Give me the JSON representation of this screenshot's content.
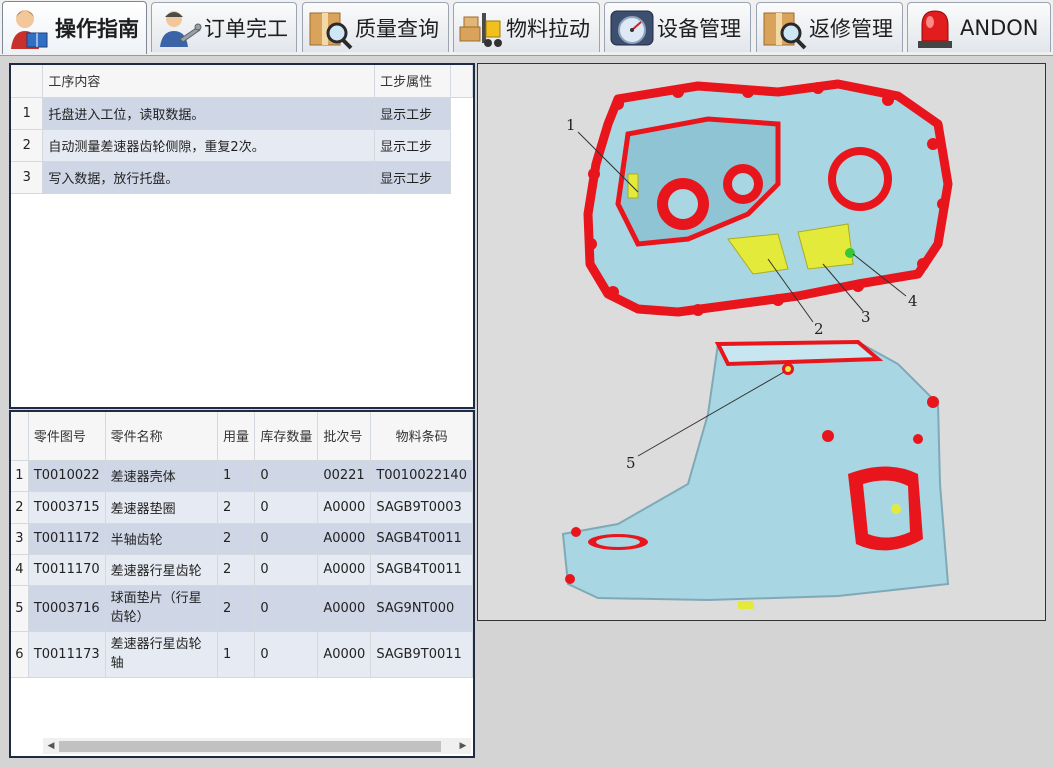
{
  "tabs": [
    {
      "label": "操作指南",
      "icon": "operator-book-icon",
      "active": true
    },
    {
      "label": "订单完工",
      "icon": "worker-wrench-icon",
      "active": false
    },
    {
      "label": "质量查询",
      "icon": "box-magnifier-icon",
      "active": false
    },
    {
      "label": "物料拉动",
      "icon": "forklift-icon",
      "active": false
    },
    {
      "label": "设备管理",
      "icon": "gauge-icon",
      "active": false
    },
    {
      "label": "返修管理",
      "icon": "box-magnifier-icon",
      "active": false
    },
    {
      "label": "ANDON",
      "icon": "alarm-light-icon",
      "active": false
    }
  ],
  "steps_table": {
    "headers": {
      "content": "工序内容",
      "attribute": "工步属性"
    },
    "rows": [
      {
        "index": "1",
        "content": "托盘进入工位，读取数据。",
        "attribute": "显示工步"
      },
      {
        "index": "2",
        "content": "自动测量差速器齿轮侧隙，重复2次。",
        "attribute": "显示工步"
      },
      {
        "index": "3",
        "content": "写入数据，放行托盘。",
        "attribute": "显示工步"
      }
    ]
  },
  "parts_table": {
    "headers": {
      "part_no": "零件图号",
      "part_name": "零件名称",
      "qty": "用量",
      "stock": "库存数量",
      "batch": "批次号",
      "barcode": "物料条码"
    },
    "rows": [
      {
        "index": "1",
        "part_no": "T0010022",
        "part_name": "差速器壳体",
        "qty": "1",
        "stock": "0",
        "batch": "00221",
        "barcode": "T0010022140"
      },
      {
        "index": "2",
        "part_no": "T0003715",
        "part_name": "差速器垫圈",
        "qty": "2",
        "stock": "0",
        "batch": "A0000",
        "barcode": "SAGB9T0003"
      },
      {
        "index": "3",
        "part_no": "T0011172",
        "part_name": "半轴齿轮",
        "qty": "2",
        "stock": "0",
        "batch": "A0000",
        "barcode": "SAGB4T0011"
      },
      {
        "index": "4",
        "part_no": "T0011170",
        "part_name": "差速器行星齿轮",
        "qty": "2",
        "stock": "0",
        "batch": "A0000",
        "barcode": "SAGB4T0011"
      },
      {
        "index": "5",
        "part_no": "T0003716",
        "part_name": "球面垫片（行星齿轮）",
        "qty": "2",
        "stock": "0",
        "batch": "A0000",
        "barcode": "SAG9NT000"
      },
      {
        "index": "6",
        "part_no": "T0011173",
        "part_name": "差速器行星齿轮轴",
        "qty": "1",
        "stock": "0",
        "batch": "A0000",
        "barcode": "SAGB9T0011"
      }
    ]
  },
  "diagram": {
    "callouts": [
      "1",
      "2",
      "3",
      "4",
      "5"
    ],
    "colors": {
      "housing": "#a9d6e3",
      "highlight": "#e8161c",
      "parts": "#e4ea3a",
      "background": "#dcdcdc"
    }
  },
  "colors": {
    "row_odd": "#cfd6e6",
    "row_even": "#e6eaf2",
    "panel_border": "#1f2a44"
  }
}
